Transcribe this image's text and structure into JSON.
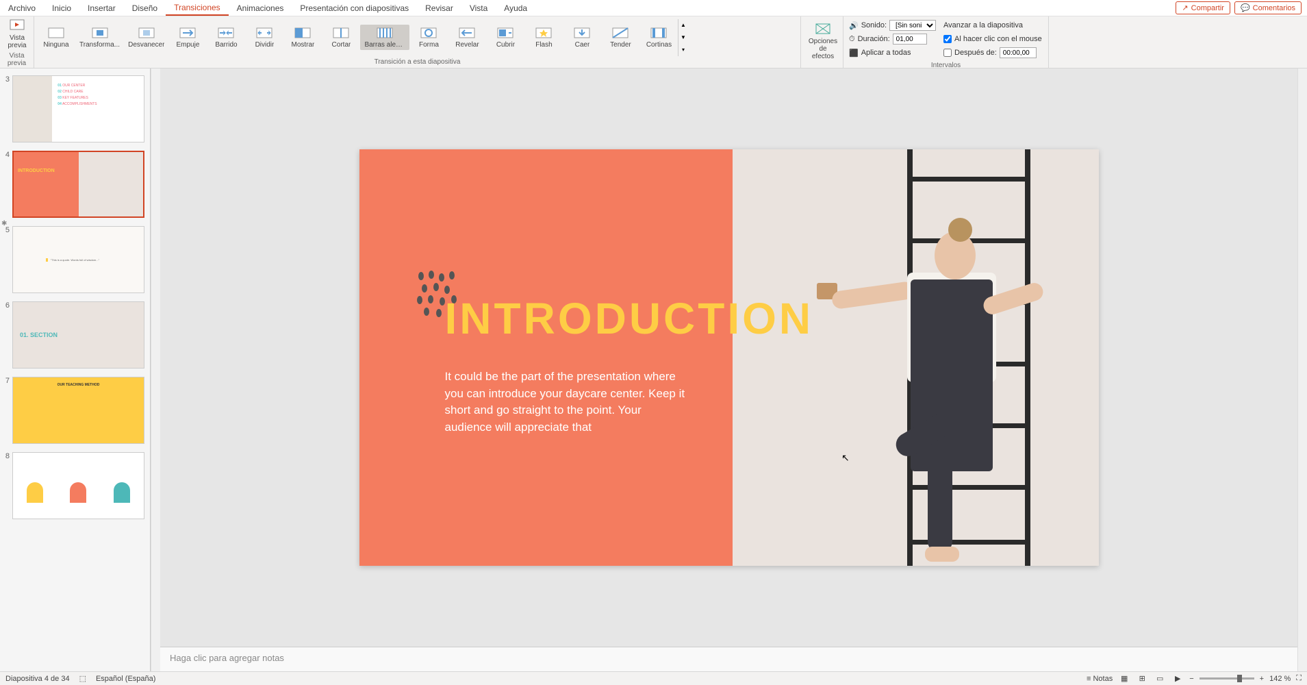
{
  "menu": {
    "items": [
      "Archivo",
      "Inicio",
      "Insertar",
      "Diseño",
      "Transiciones",
      "Animaciones",
      "Presentación con diapositivas",
      "Revisar",
      "Vista",
      "Ayuda"
    ],
    "active_index": 4,
    "share": "Compartir",
    "comments": "Comentarios"
  },
  "ribbon": {
    "preview": {
      "label": "Vista previa",
      "group": "Vista previa"
    },
    "transitions": {
      "group": "Transición a esta diapositiva",
      "items": [
        {
          "label": "Ninguna"
        },
        {
          "label": "Transforma..."
        },
        {
          "label": "Desvanecer"
        },
        {
          "label": "Empuje"
        },
        {
          "label": "Barrido"
        },
        {
          "label": "Dividir"
        },
        {
          "label": "Mostrar"
        },
        {
          "label": "Cortar"
        },
        {
          "label": "Barras aleat..."
        },
        {
          "label": "Forma"
        },
        {
          "label": "Revelar"
        },
        {
          "label": "Cubrir"
        },
        {
          "label": "Flash"
        },
        {
          "label": "Caer"
        },
        {
          "label": "Tender"
        },
        {
          "label": "Cortinas"
        }
      ],
      "selected_index": 8,
      "effect_options": "Opciones de efectos"
    },
    "timing": {
      "group": "Intervalos",
      "sound_label": "Sonido:",
      "sound_value": "[Sin sonido]",
      "duration_label": "Duración:",
      "duration_value": "01,00",
      "apply_all": "Aplicar a todas",
      "advance_label": "Avanzar a la diapositiva",
      "on_click": "Al hacer clic con el mouse",
      "on_click_checked": true,
      "after_label": "Después de:",
      "after_value": "00:00,00",
      "after_checked": false
    }
  },
  "thumbnails": [
    {
      "num": "3"
    },
    {
      "num": "4",
      "active": true,
      "star": true
    },
    {
      "num": "5"
    },
    {
      "num": "6"
    },
    {
      "num": "7"
    },
    {
      "num": "8"
    }
  ],
  "slide": {
    "title": "INTRODUCTION",
    "body": "It could be the part of the presentation where you can introduce your daycare center. Keep it short and go straight to the point. Your audience will appreciate that"
  },
  "notes": {
    "placeholder": "Haga clic para agregar notas"
  },
  "status": {
    "slide_info": "Diapositiva 4 de 34",
    "language": "Español (España)",
    "notes_btn": "Notas",
    "zoom": "142 %"
  },
  "thumb_content": {
    "t4_title": "INTRODUCTION",
    "t6_title": "01. SECTION",
    "t7_title": "OUR TEACHING METHOD"
  }
}
